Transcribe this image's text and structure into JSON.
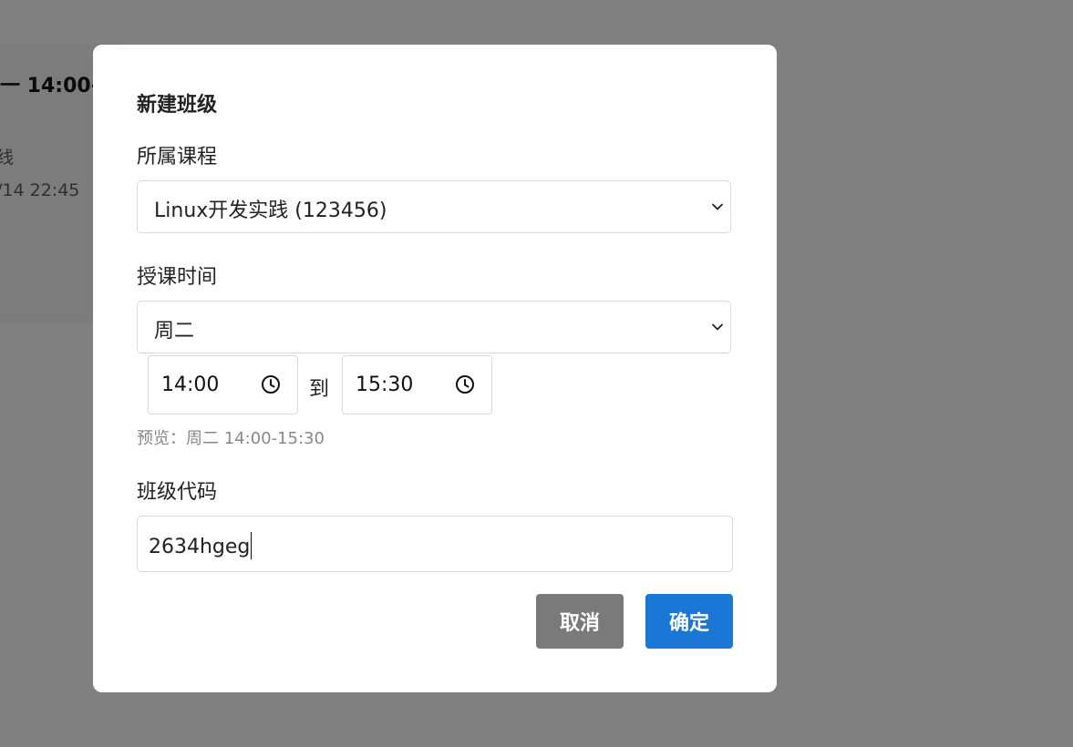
{
  "background": {
    "title": "一 14:00-",
    "line1": "线",
    "line2": "/14 22:45"
  },
  "modal": {
    "title": "新建班级",
    "course": {
      "label": "所属课程",
      "selected": "Linux开发实践 (123456)"
    },
    "schedule": {
      "label": "授课时间",
      "day_selected": "周二",
      "start_time": "14:00",
      "separator": "到",
      "end_time": "15:30",
      "preview": "预览：周二 14:00-15:30"
    },
    "class_code": {
      "label": "班级代码",
      "value": "2634hgeg"
    },
    "buttons": {
      "cancel": "取消",
      "confirm": "确定"
    }
  },
  "colors": {
    "overlay": "#808080",
    "cancel_button": "#7a7a7a",
    "confirm_button": "#1b77d6"
  },
  "icons": [
    "chevron-down-icon",
    "clock-icon"
  ]
}
